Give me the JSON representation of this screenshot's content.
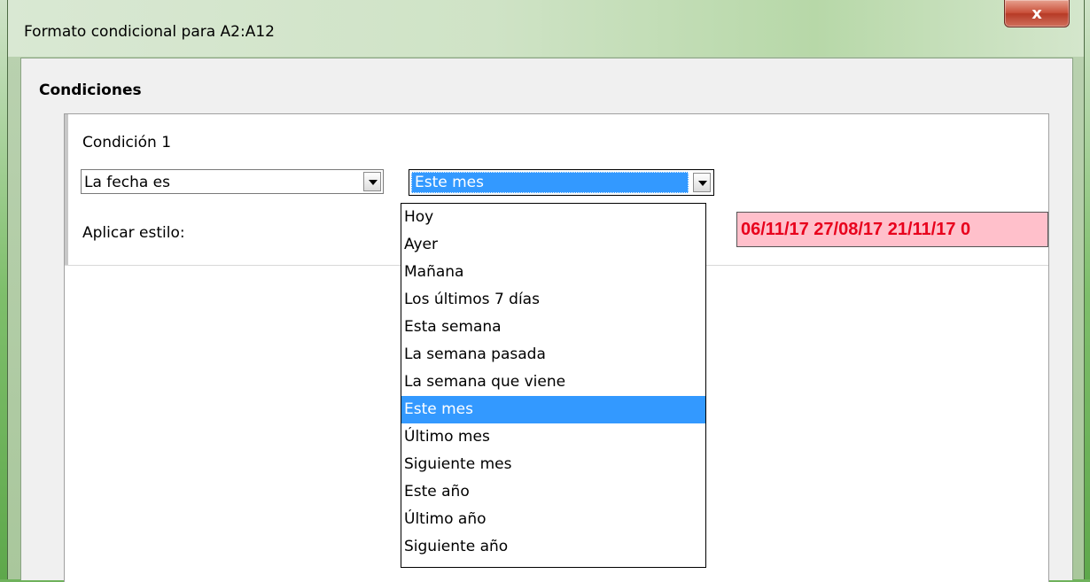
{
  "window": {
    "title": "Formato condicional para A2:A12",
    "close_label": "x"
  },
  "conditions_section": {
    "label": "Condiciones"
  },
  "condition1": {
    "title": "Condición 1",
    "type_select": {
      "value": "La fecha es"
    },
    "date_select": {
      "value": "Este mes"
    },
    "apply_style_label": "Aplicar estilo:",
    "preview_text": " 06/11/17 27/08/17 21/11/17 0"
  },
  "dropdown": {
    "options": [
      "Hoy",
      "Ayer",
      "Mañana",
      "Los últimos 7 días",
      "Esta semana",
      "La semana pasada",
      "La semana que viene",
      "Este mes",
      "Último mes",
      "Siguiente mes",
      "Este año",
      "Último año",
      "Siguiente año"
    ],
    "selected": "Este mes"
  },
  "colors": {
    "selection": "#3399ff",
    "preview_bg": "#ffc0cb",
    "preview_text": "#e8001c"
  }
}
